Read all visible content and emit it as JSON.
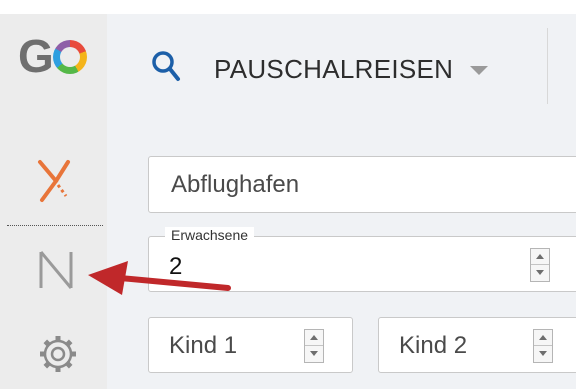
{
  "colors": {
    "sidebar_bg": "#ececec",
    "content_bg": "#f0f2f5",
    "search_blue": "#1c5fa8",
    "x_orange": "#e8753a",
    "arrow_red": "#c0282a"
  },
  "sidebar": {
    "logo_text": "GO",
    "items": [
      {
        "icon": "x-logo-icon"
      },
      {
        "icon": "n-logo-icon"
      },
      {
        "icon": "gear-icon"
      }
    ]
  },
  "header": {
    "search_icon": "search-icon",
    "nav_label": "PAUSCHALREISEN"
  },
  "form": {
    "departure": {
      "placeholder": "Abflughafen"
    },
    "adults": {
      "legend": "Erwachsene",
      "value": "2"
    },
    "child1": {
      "placeholder": "Kind 1"
    },
    "child2": {
      "placeholder": "Kind 2"
    }
  },
  "annotation": {
    "icon": "red-arrow-icon"
  }
}
